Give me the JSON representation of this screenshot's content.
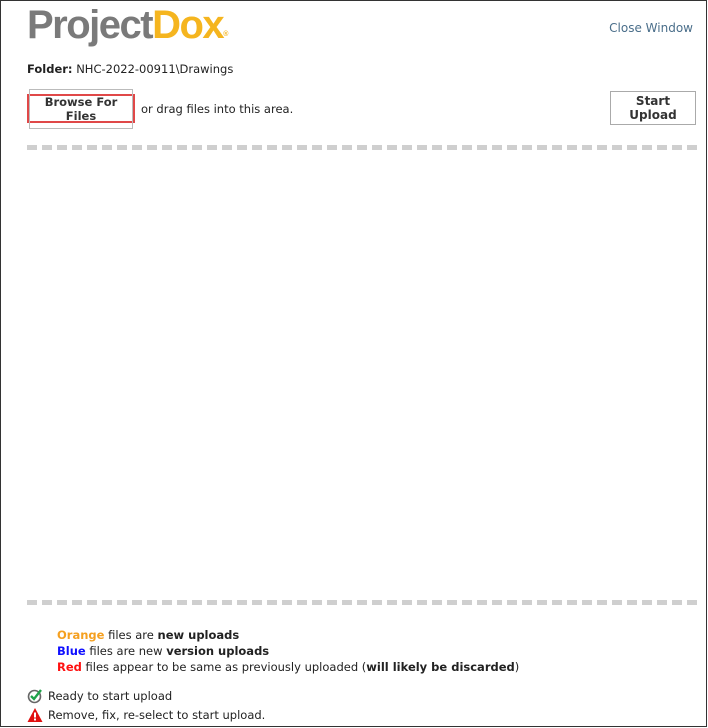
{
  "header": {
    "logo_part1": "Project",
    "logo_part2": "Dox",
    "logo_mark": "®",
    "close_label": "Close Window"
  },
  "folder": {
    "label": "Folder:",
    "path": "NHC-2022-00911\\Drawings"
  },
  "toolbar": {
    "browse_label": "Browse For Files",
    "drag_hint": "or drag files into this area.",
    "start_label": "Start Upload"
  },
  "legend": {
    "orange": {
      "word": "Orange",
      "mid": " files are ",
      "bold": "new uploads"
    },
    "blue": {
      "word": "Blue",
      "mid": " files are new ",
      "bold": "version uploads"
    },
    "red": {
      "word": "Red",
      "mid": " files appear to be same as previously uploaded (",
      "bold": "will likely be discarded",
      "end": ")"
    }
  },
  "status": {
    "ready": "Ready to start upload",
    "error": "Remove, fix, re-select to start upload."
  },
  "colors": {
    "orange": "#f5a020",
    "blue": "#1010ff",
    "red": "#ff1010",
    "highlight": "#e04848"
  }
}
